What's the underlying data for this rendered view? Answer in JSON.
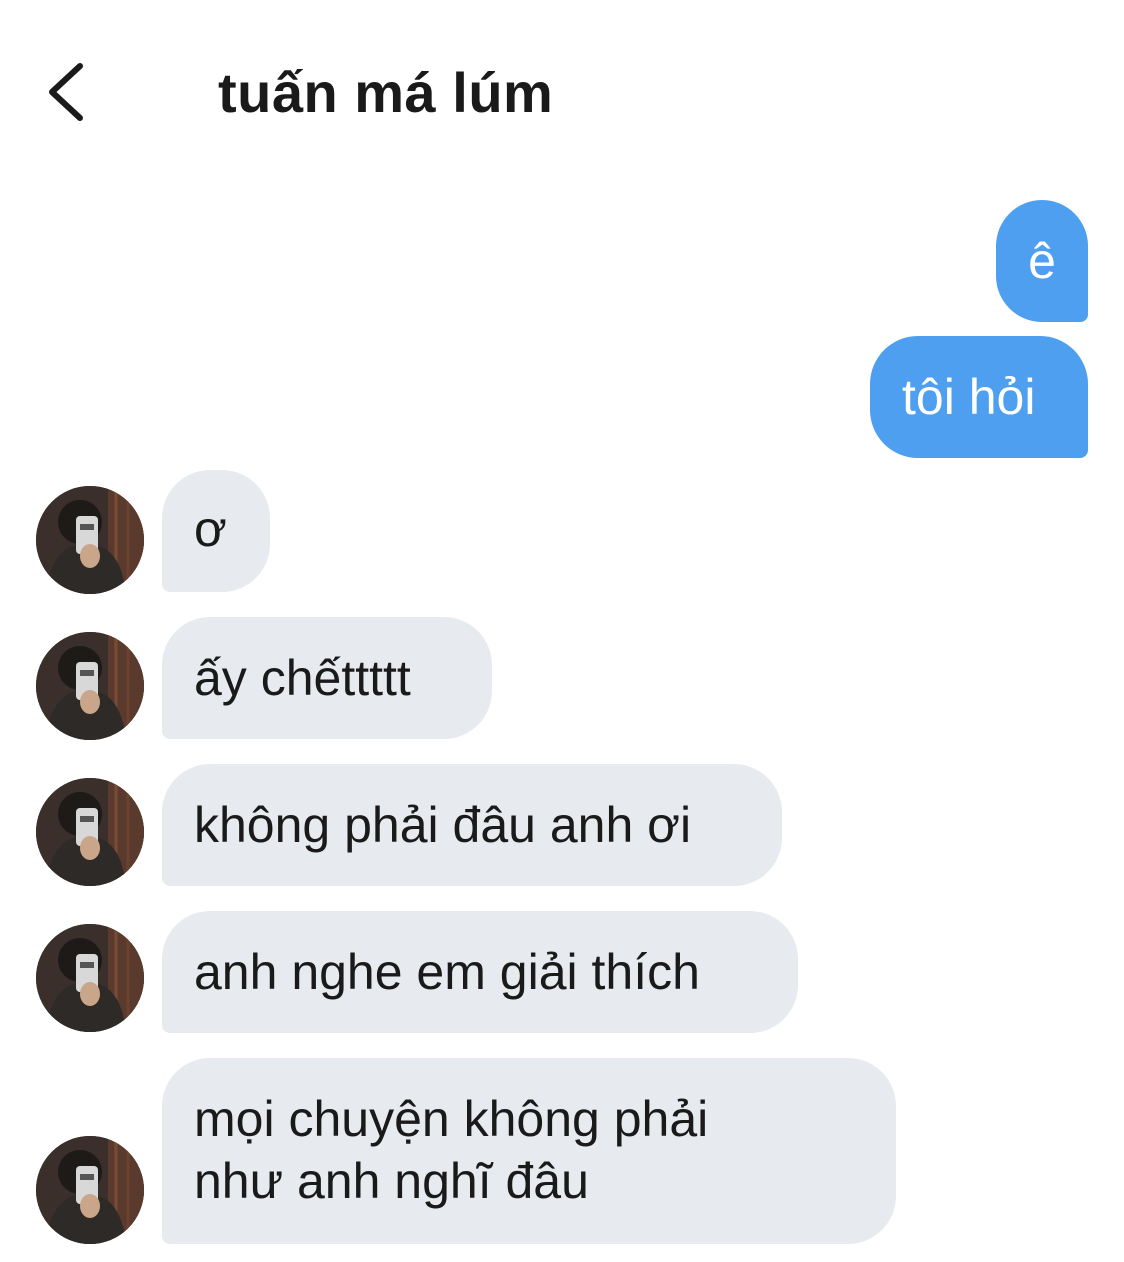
{
  "header": {
    "title": "tuấn má lúm",
    "back_icon": "chevron-left-icon"
  },
  "messages": {
    "out_1": "ê",
    "out_2": "tôi hỏi",
    "in_1": "ơ",
    "in_2": "ấy chếttttt",
    "in_3": "không phải đâu anh ơi",
    "in_4": "anh nghe em giải thích",
    "in_5_line1": "mọi chuyện không phải",
    "in_5_line2": "như anh nghĩ đâu"
  },
  "colors": {
    "outgoing_bubble": "#4e9ff0",
    "incoming_bubble": "#e7ebf0",
    "text": "#1a1a1a"
  }
}
